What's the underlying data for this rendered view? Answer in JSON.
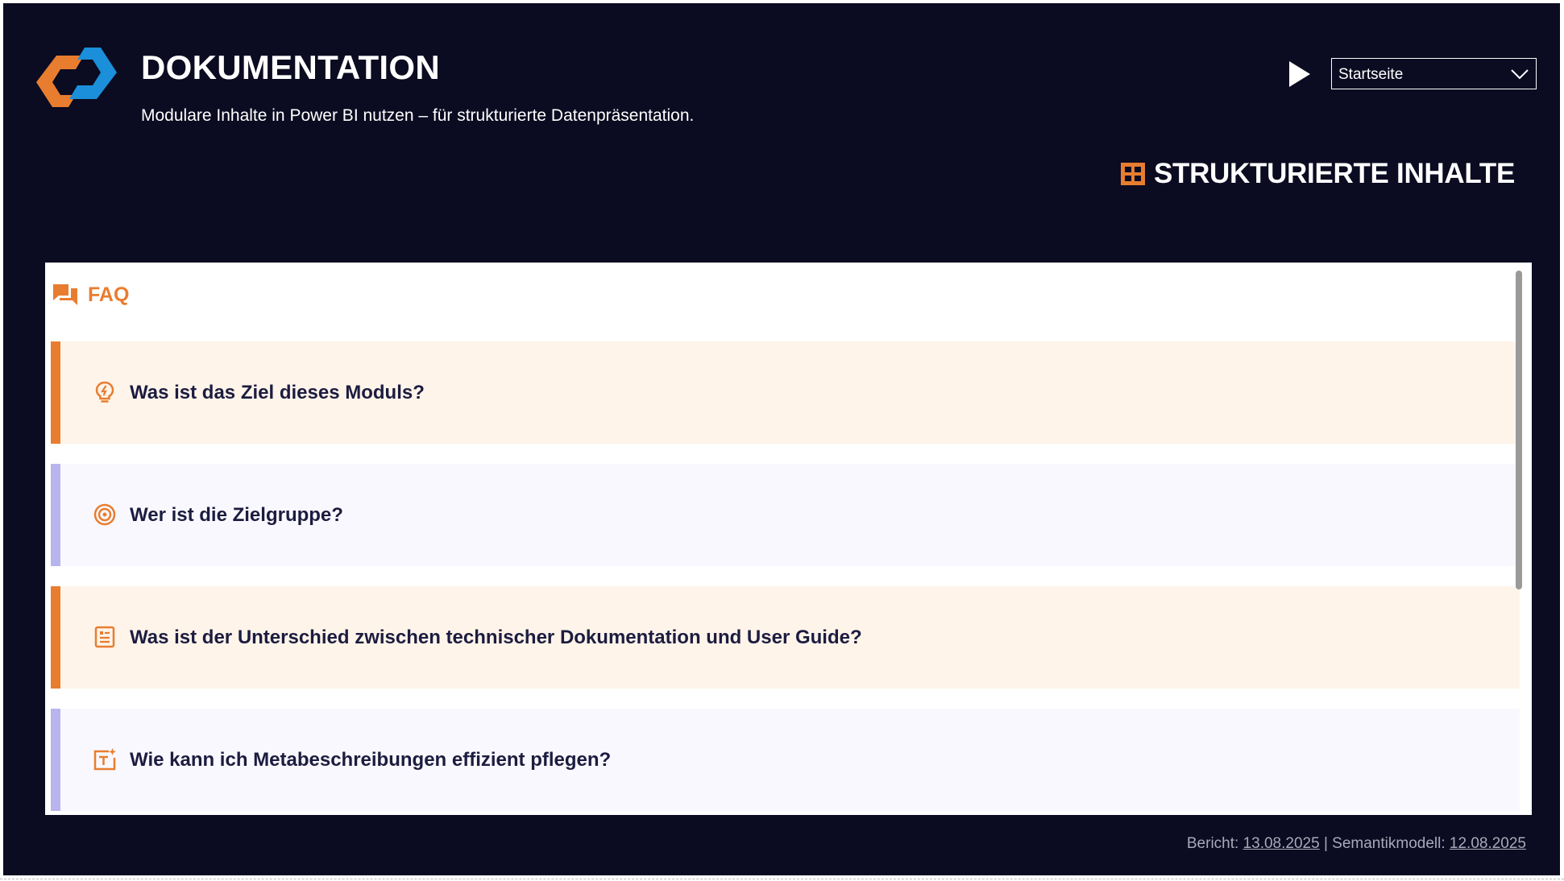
{
  "header": {
    "title": "DOKUMENTATION",
    "subtitle": "Modulare Inhalte in Power BI nutzen – für strukturierte Datenpräsentation."
  },
  "controls": {
    "play_icon": "play-icon",
    "page_select": {
      "value": "Startseite",
      "icon": "chevron-down-icon"
    }
  },
  "section": {
    "title": "STRUKTURIERTE INHALTE",
    "icon": "grid-icon"
  },
  "faq": {
    "label": "FAQ",
    "icon": "chat-icon",
    "items": [
      {
        "question": "Was ist das Ziel dieses Moduls?",
        "icon": "lightbulb-icon",
        "accent": "#e87d2f"
      },
      {
        "question": "Wer ist die Zielgruppe?",
        "icon": "target-icon",
        "accent": "#b7b4ee"
      },
      {
        "question": "Was ist der Unterschied zwischen technischer Dokumentation und User Guide?",
        "icon": "document-icon",
        "accent": "#e87d2f"
      },
      {
        "question": "Wie kann ich Metabeschreibungen effizient pflegen?",
        "icon": "text-edit-icon",
        "accent": "#b7b4ee"
      }
    ]
  },
  "footer": {
    "report_label": "Bericht:",
    "report_date": "13.08.2025",
    "separator": "|",
    "model_label": "Semantikmodell:",
    "model_date": "12.08.2025"
  },
  "colors": {
    "background": "#0b0b21",
    "accent_orange": "#e87d2f",
    "accent_blue": "#1b8fd9",
    "accent_purple": "#b7b4ee",
    "text_dark": "#1c1c40"
  }
}
